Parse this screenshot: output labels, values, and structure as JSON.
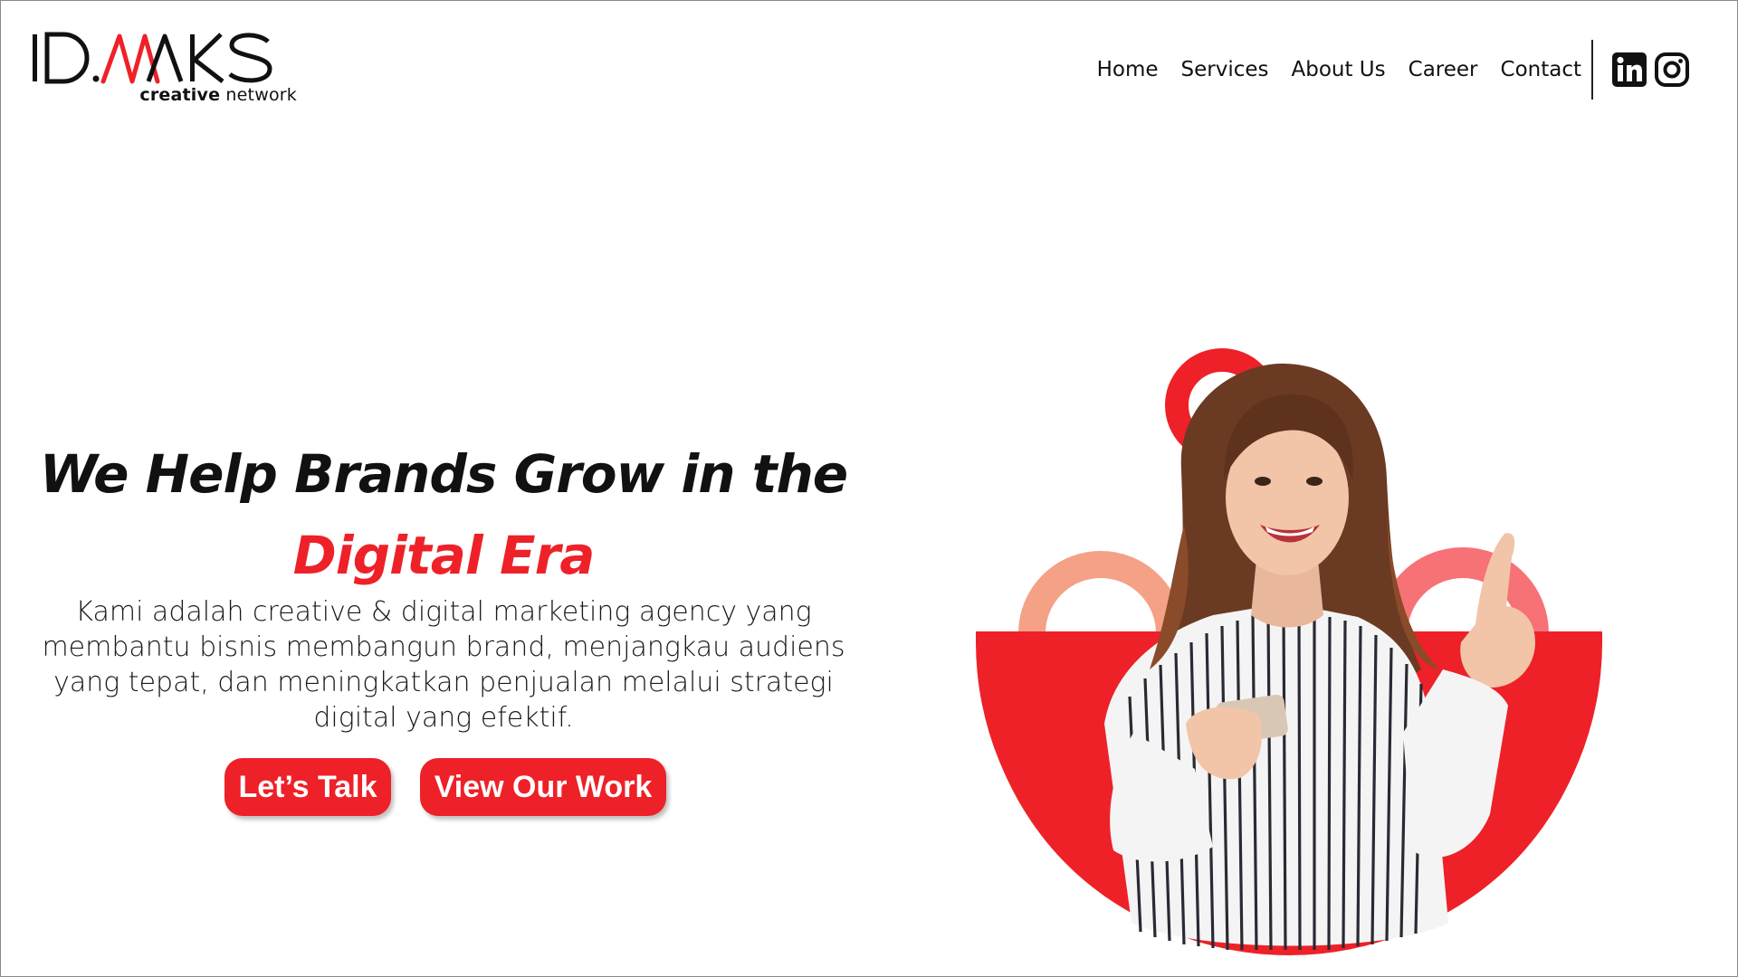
{
  "brand": {
    "logo_text": "ID.MAKS",
    "tagline_bold": "creative",
    "tagline_rest": " network",
    "accent_color": "#ee2128"
  },
  "nav": {
    "items": [
      {
        "label": "Home"
      },
      {
        "label": "Services"
      },
      {
        "label": "About Us"
      },
      {
        "label": "Career"
      },
      {
        "label": "Contact"
      }
    ],
    "social": [
      "linkedin-icon",
      "instagram-icon"
    ]
  },
  "hero": {
    "title_line1": "We Help Brands Grow in the",
    "title_line2": "Digital Era",
    "description": "Kami adalah creative & digital marketing agency yang membantu bisnis membangun brand, menjangkau audiens yang tepat, dan meningkatkan penjualan melalui strategi digital yang efektif.",
    "cta_primary": "Let’s Talk",
    "cta_secondary": "View Our Work"
  }
}
